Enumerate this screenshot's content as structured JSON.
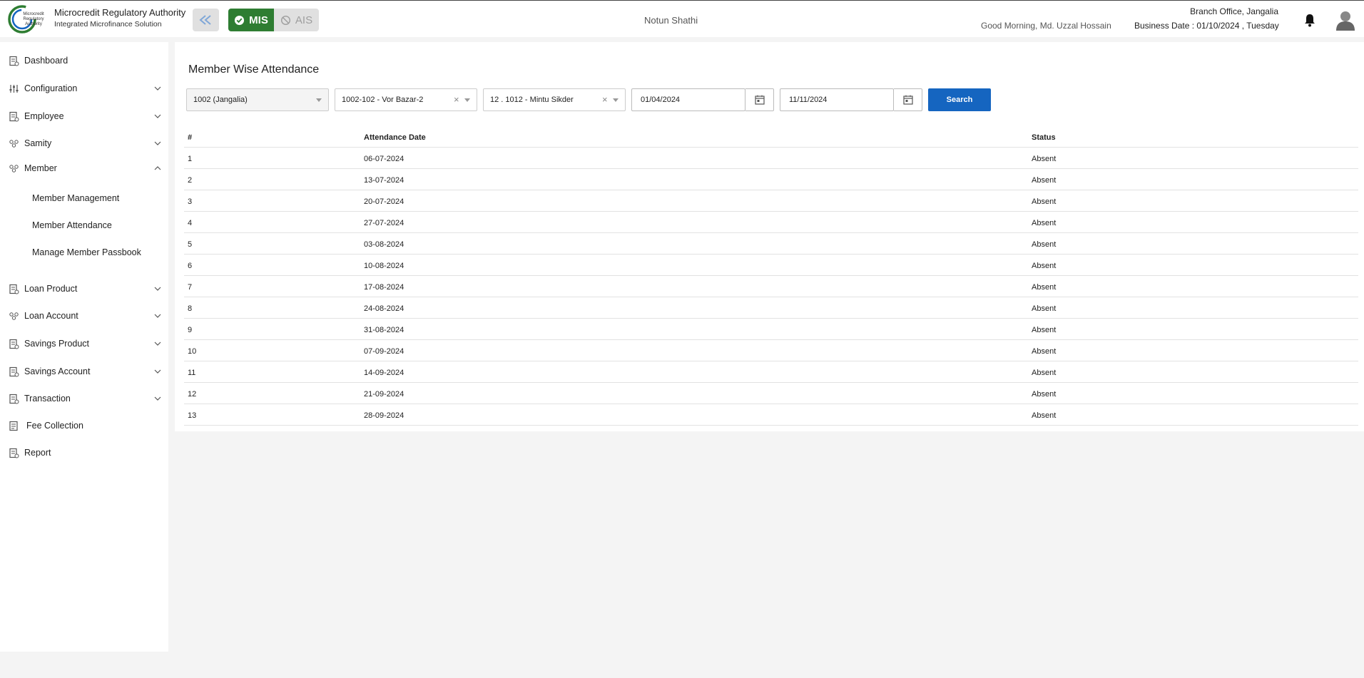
{
  "header": {
    "brand_title": "Microcredit Regulatory Authority",
    "brand_subtitle": "Integrated Microfinance Solution",
    "logo_text": "Microcredit Regulatory Authority",
    "mode_mis": "MIS",
    "mode_ais": "AIS",
    "organization": "Notun Shathi",
    "greeting": "Good Morning, Md. Uzzal Hossain",
    "branch": "Branch Office, Jangalia",
    "business_date": "Business Date : 01/10/2024 , Tuesday",
    "colors": {
      "mis_active": "#2e7d32",
      "accent": "#1565c0"
    }
  },
  "sidebar": {
    "items": [
      {
        "label": "Dashboard",
        "icon": "document-icon"
      },
      {
        "label": "Configuration",
        "icon": "sliders-icon"
      },
      {
        "label": "Employee",
        "icon": "document-icon"
      },
      {
        "label": "Samity",
        "icon": "group-icon"
      },
      {
        "label": "Member",
        "icon": "group-icon"
      },
      {
        "label": "Loan Product",
        "icon": "document-icon"
      },
      {
        "label": "Loan Account",
        "icon": "group-icon"
      },
      {
        "label": "Savings Product",
        "icon": "document-icon"
      },
      {
        "label": "Savings Account",
        "icon": "document-icon"
      },
      {
        "label": "Transaction",
        "icon": "document-icon"
      },
      {
        "label": "Fee Collection",
        "icon": "document-icon"
      },
      {
        "label": "Report",
        "icon": "document-icon"
      }
    ],
    "member_sub": [
      "Member Management",
      "Member Attendance",
      "Manage Member Passbook"
    ]
  },
  "main": {
    "title": "Member Wise Attendance",
    "filters": {
      "branch": "1002 (Jangalia)",
      "samity": "1002-102 - Vor Bazar-2",
      "member": "12 . 1012 - Mintu Sikder",
      "from_date": "01/04/2024",
      "to_date": "11/11/2024",
      "search_label": "Search",
      "clear_symbol": "×"
    },
    "table": {
      "headers": [
        "#",
        "Attendance Date",
        "Status"
      ],
      "rows": [
        [
          "1",
          "06-07-2024",
          "Absent"
        ],
        [
          "2",
          "13-07-2024",
          "Absent"
        ],
        [
          "3",
          "20-07-2024",
          "Absent"
        ],
        [
          "4",
          "27-07-2024",
          "Absent"
        ],
        [
          "5",
          "03-08-2024",
          "Absent"
        ],
        [
          "6",
          "10-08-2024",
          "Absent"
        ],
        [
          "7",
          "17-08-2024",
          "Absent"
        ],
        [
          "8",
          "24-08-2024",
          "Absent"
        ],
        [
          "9",
          "31-08-2024",
          "Absent"
        ],
        [
          "10",
          "07-09-2024",
          "Absent"
        ],
        [
          "11",
          "14-09-2024",
          "Absent"
        ],
        [
          "12",
          "21-09-2024",
          "Absent"
        ],
        [
          "13",
          "28-09-2024",
          "Absent"
        ]
      ]
    }
  }
}
